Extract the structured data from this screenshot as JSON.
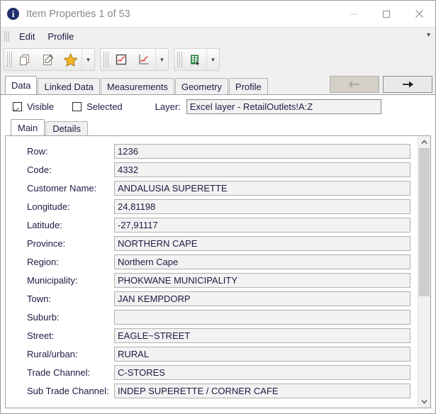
{
  "window": {
    "title": "Item Properties 1 of 53",
    "info_icon": "info-icon",
    "minimize_label": "minimize-icon",
    "maximize_label": "maximize-icon",
    "close_label": "close-icon"
  },
  "menubar": {
    "items": [
      {
        "label": "Edit"
      },
      {
        "label": "Profile"
      }
    ],
    "overflow_glyph": "▼"
  },
  "toolbar": {
    "groups": [
      {
        "buttons": [
          {
            "icon": "copy-icon"
          },
          {
            "icon": "edit-note-icon"
          },
          {
            "icon": "star-icon"
          }
        ],
        "split_glyph": "▼"
      },
      {
        "buttons": [
          {
            "icon": "chart-boxed-icon"
          },
          {
            "icon": "chart-axes-icon"
          }
        ],
        "split_glyph": "▼"
      },
      {
        "buttons": [
          {
            "icon": "excel-export-icon"
          }
        ],
        "split_glyph": "▼"
      }
    ]
  },
  "tabs": {
    "items": [
      {
        "label": "Data",
        "active": true
      },
      {
        "label": "Linked Data",
        "active": false
      },
      {
        "label": "Measurements",
        "active": false
      },
      {
        "label": "Geometry",
        "active": false
      },
      {
        "label": "Profile",
        "active": false
      }
    ],
    "nav_prev": "<-",
    "nav_next": "->",
    "nav_prev_enabled": false,
    "nav_next_enabled": true
  },
  "options": {
    "visible_label": "Visible",
    "visible_checked": true,
    "selected_label": "Selected",
    "selected_checked": false,
    "layer_label": "Layer:",
    "layer_value": "Excel layer - RetailOutlets!A:Z"
  },
  "inner_tabs": {
    "items": [
      {
        "label": "Main",
        "active": true
      },
      {
        "label": "Details",
        "active": false
      }
    ]
  },
  "fields": [
    {
      "label": "Row:",
      "value": "1236"
    },
    {
      "label": "Code:",
      "value": "4332"
    },
    {
      "label": "Customer Name:",
      "value": "ANDALUSIA SUPERETTE"
    },
    {
      "label": "Longitude:",
      "value": "24,81198"
    },
    {
      "label": "Latitude:",
      "value": "-27,91117"
    },
    {
      "label": "Province:",
      "value": "NORTHERN CAPE"
    },
    {
      "label": "Region:",
      "value": "Northern Cape"
    },
    {
      "label": "Municipality:",
      "value": "PHOKWANE MUNICIPALITY"
    },
    {
      "label": "Town:",
      "value": "JAN KEMPDORP"
    },
    {
      "label": "Suburb:",
      "value": ""
    },
    {
      "label": "Street:",
      "value": "EAGLE~STREET"
    },
    {
      "label": "Rural/urban:",
      "value": "RURAL"
    },
    {
      "label": "Trade Channel:",
      "value": "C-STORES"
    },
    {
      "label": "Sub Trade Channel:",
      "value": "INDEP SUPERETTE / CORNER CAFE"
    }
  ],
  "scrollbar": {
    "up_glyph": "︿",
    "down_glyph": "﹀",
    "thumb_top_pct": 0,
    "thumb_height_pct": 60
  },
  "colors": {
    "accent": "#1f2f6b",
    "field_bg": "#f2f2f2",
    "text": "#1b1b44",
    "star": "#f0b528",
    "excel_green": "#1d7a3d",
    "chart_red": "#e03c3c"
  }
}
